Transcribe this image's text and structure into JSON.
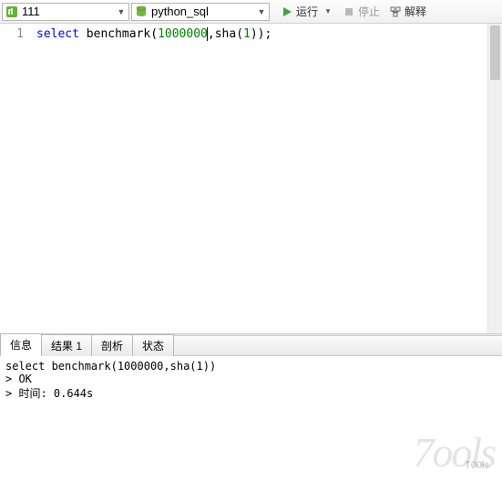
{
  "toolbar": {
    "connection": {
      "icon": "connection-icon",
      "label": "111"
    },
    "database": {
      "icon": "database-icon",
      "label": "python_sql"
    },
    "run": {
      "icon": "play-icon",
      "label": "运行"
    },
    "stop": {
      "icon": "stop-icon",
      "label": "停止"
    },
    "explain": {
      "icon": "explain-icon",
      "label": "解释"
    }
  },
  "editor": {
    "line_number": "1",
    "code": {
      "keyword": "select",
      "func1": "benchmark",
      "paren1": "(",
      "num1": "1000000",
      "comma": ",",
      "func2": "sha",
      "paren2": "(",
      "num2": "1",
      "paren3": ")",
      "paren4": ")",
      "semi": ";"
    }
  },
  "tabs": {
    "info": "信息",
    "result": "结果 1",
    "profile": "剖析",
    "status": "状态"
  },
  "output": {
    "line1": "select benchmark(1000000,sha(1))",
    "line2": "> OK",
    "line3": "> 时间: 0.644s"
  },
  "watermark": {
    "main": "7ools",
    "sub": "T00ls"
  }
}
